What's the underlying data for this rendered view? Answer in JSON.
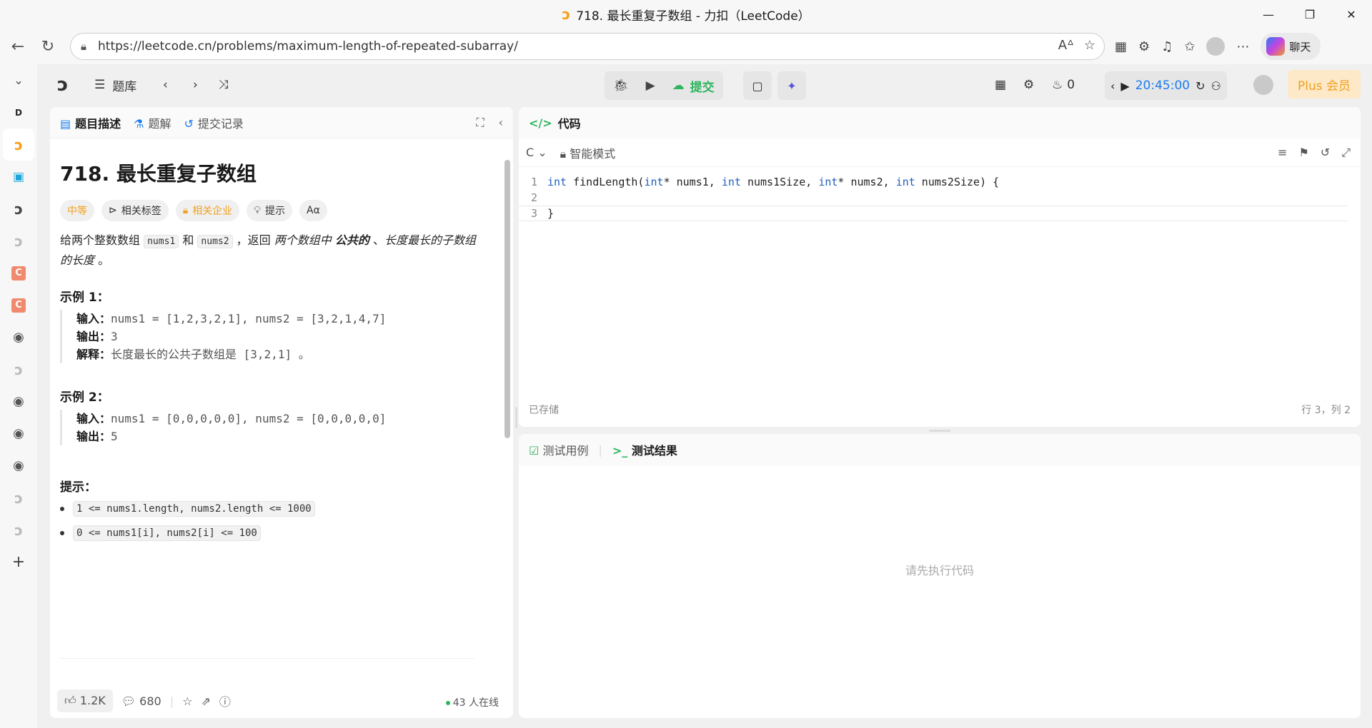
{
  "window": {
    "title": "718. 最长重复子数组 - 力扣（LeetCode）",
    "minimize": "—",
    "maximize": "❐",
    "close": "✕"
  },
  "browser": {
    "url": "https://leetcode.cn/problems/maximum-length-of-repeated-subarray/",
    "chat_label": "聊天"
  },
  "topnav": {
    "problem_list": "题库",
    "submit": "提交",
    "fire_count": "0",
    "timer": "20:45:00",
    "plus": "Plus 会员"
  },
  "left_tabs": {
    "description": "题目描述",
    "solutions": "题解",
    "submissions": "提交记录"
  },
  "problem": {
    "title": "718. 最长重复子数组",
    "difficulty": "中等",
    "tag_related": "相关标签",
    "tag_company": "相关企业",
    "tag_hint": "提示",
    "tag_font": "Aα",
    "desc_pre": "给两个整数数组 ",
    "nums1": "nums1",
    "desc_and": " 和 ",
    "nums2": "nums2",
    "desc_ret": " ，返回 ",
    "desc_em1": "两个数组中 ",
    "desc_strong": "公共的",
    "desc_sep": " 、",
    "desc_em2": "长度最长的子数组的长度",
    "desc_end": " 。",
    "example1": {
      "heading": "示例 1：",
      "input_label": "输入：",
      "input": "nums1 = [1,2,3,2,1], nums2 = [3,2,1,4,7]",
      "output_label": "输出：",
      "output": "3",
      "explain_label": "解释：",
      "explain": "长度最长的公共子数组是 [3,2,1] 。"
    },
    "example2": {
      "heading": "示例 2：",
      "input_label": "输入：",
      "input": "nums1 = [0,0,0,0,0], nums2 = [0,0,0,0,0]",
      "output_label": "输出：",
      "output": "5"
    },
    "hints_heading": "提示：",
    "constraint1": "1 <= nums1.length, nums2.length <= 1000",
    "constraint2": "0 <= nums1[i], nums2[i] <= 100"
  },
  "footer": {
    "likes": "1.2K",
    "comments": "680",
    "online": "43 人在线"
  },
  "code_panel": {
    "title": "代码",
    "language": "C",
    "mode": "智能模式",
    "line1_no": "1",
    "line2_no": "2",
    "line3_no": "3",
    "line3": "}",
    "saved": "已存储",
    "cursor": "行 3，列 2"
  },
  "test_panel": {
    "tab_cases": "测试用例",
    "tab_results": "测试结果",
    "empty": "请先执行代码"
  },
  "icons": [
    "back-arrow-icon",
    "refresh-icon",
    "lock-icon",
    "read-aloud-icon",
    "star-icon",
    "qr-icon",
    "extension-icon",
    "music-icon",
    "favorites-icon",
    "profile-icon",
    "more-icon",
    "leetcode-logo-icon",
    "list-icon",
    "chevron-left-icon",
    "chevron-right-icon",
    "shuffle-icon",
    "debug-icon",
    "run-icon",
    "upload-icon",
    "note-icon",
    "sparkle-icon",
    "layout-icon",
    "gear-icon",
    "fire-icon",
    "reset-icon",
    "add-user-icon",
    "github-icon",
    "plus-icon",
    "expand-icon",
    "collapse-icon",
    "thumbs-up-icon",
    "comment-icon",
    "share-icon",
    "help-icon",
    "code-icon",
    "checkbox-icon",
    "terminal-icon",
    "format-icon",
    "bookmark-icon",
    "undo-icon",
    "fullscreen-icon"
  ]
}
